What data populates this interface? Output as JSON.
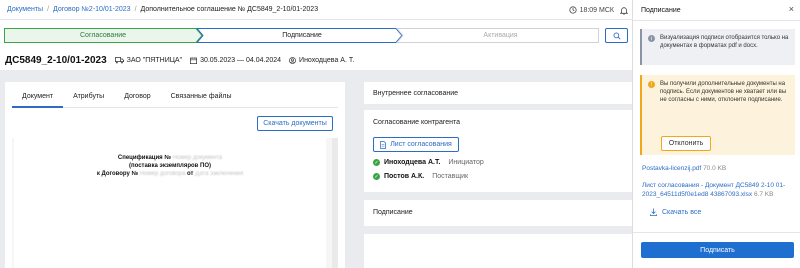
{
  "breadcrumb": {
    "items": [
      "Документы",
      "Договор №2-10/01-2023"
    ],
    "current": "Дополнительное соглашение № ДС5849_2-10/01-2023"
  },
  "clock": {
    "time": "18:09 МСК"
  },
  "steps": [
    {
      "label": "Согласование",
      "state": "done"
    },
    {
      "label": "Подписание",
      "state": "active"
    },
    {
      "label": "Активация",
      "state": "pending"
    }
  ],
  "document": {
    "title": "ДС5849_2-10/01-2023",
    "company": "ЗАО \"ПЯТНИЦА\"",
    "period": "30.05.2023 — 04.04.2024",
    "owner": "Иноходцева А. Т."
  },
  "tabs": [
    "Документ",
    "Атрибуты",
    "Договор",
    "Связанные файлы"
  ],
  "download_button": "Скачать документы",
  "preview": {
    "line1_label": "Спецификация №",
    "line1_blur": "Номер документа",
    "line2": "(поставка экземпляров ПО)",
    "line3_label": "к Договору №",
    "line3_blur": "Номер договора",
    "line3_mid": "от",
    "line3_blur2": "Дата заключения"
  },
  "internal_approval": {
    "title": "Внутреннее согласование"
  },
  "counterparty_approval": {
    "title": "Согласование контрагента",
    "sheet_button": "Лист согласования",
    "signers": [
      {
        "name": "Иноходцева А.Т.",
        "role": "Инициатор"
      },
      {
        "name": "Постов А.К.",
        "role": "Поставщик"
      }
    ]
  },
  "signing_section": {
    "title": "Подписание"
  },
  "panel": {
    "title": "Подписание",
    "info_text": "Визуализация подписи отобразится только на документах в форматах pdf и docx.",
    "warning_text": "Вы получили дополнительные документы на подпись. Если документов не хватает или вы не согласны с ними, отклоните подписание.",
    "reject_button": "Отклонить",
    "files": [
      {
        "name": "Postavka-licenzij.pdf",
        "size": "70.0 KB"
      },
      {
        "name": "Лист согласования - Документ ДС5849 2-10 01-2023_64511d5f0e1ed8 43867093.xlsx",
        "size": "6.7 KB"
      }
    ],
    "download_all": "Скачать все",
    "sign_button": "Подписать"
  },
  "colors": {
    "accent": "#2b6cc4",
    "success": "#3aa548",
    "warning": "#f0a818",
    "step_done": "#eaf6ec",
    "step_done_border": "#3aa548"
  }
}
